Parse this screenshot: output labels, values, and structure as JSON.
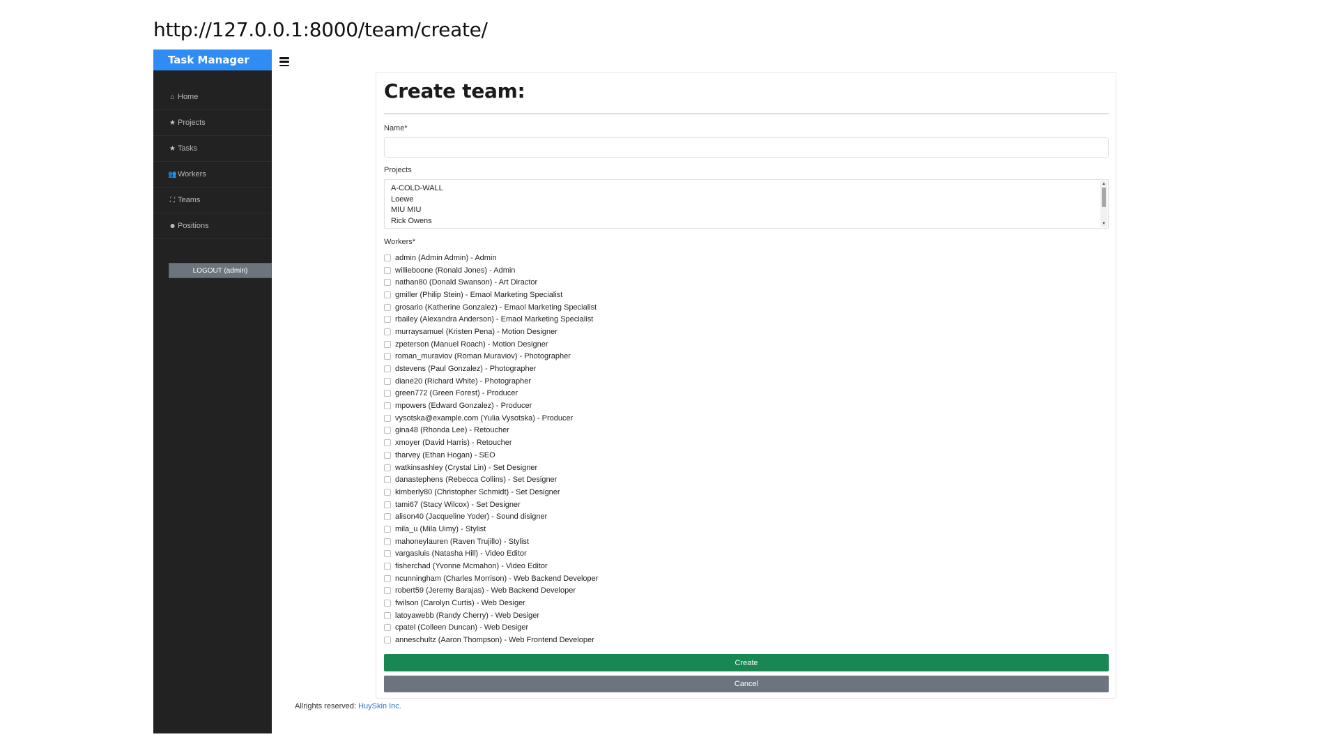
{
  "browser": {
    "url": "http://127.0.0.1:8000/team/create/"
  },
  "sidebar": {
    "brand": "Task Manager",
    "items": [
      {
        "label": "Home",
        "icon": "home-icon",
        "glyph": "⌂"
      },
      {
        "label": "Projects",
        "icon": "star-icon",
        "glyph": "★"
      },
      {
        "label": "Tasks",
        "icon": "star-icon",
        "glyph": "★"
      },
      {
        "label": "Workers",
        "icon": "users-icon",
        "glyph": "👥"
      },
      {
        "label": "Teams",
        "icon": "sitemap-icon",
        "glyph": "⛶"
      },
      {
        "label": "Positions",
        "icon": "face-icon",
        "glyph": "☻"
      }
    ],
    "logout_label": "LOGOUT (admin)"
  },
  "header": {
    "menu_icon": "hamburger-icon"
  },
  "form": {
    "title": "Create team:",
    "name_label": "Name*",
    "name_value": "",
    "projects_label": "Projects",
    "projects": [
      "A-COLD-WALL",
      "Loewe",
      "MIU MIU",
      "Rick Owens"
    ],
    "workers_label": "Workers*",
    "workers": [
      "admin (Admin Admin) - Admin",
      "willieboone (Ronald Jones) - Admin",
      "nathan80 (Donald Swanson) - Art Diractor",
      "gmiller (Philip Stein) - Emaol Marketing Specialist",
      "grosario (Katherine Gonzalez) - Emaol Marketing Specialist",
      "rbailey (Alexandra Anderson) - Emaol Marketing Specialist",
      "murraysamuel (Kristen Pena) - Motion Designer",
      "zpeterson (Manuel Roach) - Motion Designer",
      "roman_muraviov (Roman Muraviov) - Photographer",
      "dstevens (Paul Gonzalez) - Photographer",
      "diane20 (Richard White) - Photographer",
      "green772 (Green Forest) - Producer",
      "mpowers (Edward Gonzalez) - Producer",
      "vysotska@example.com (Yulia Vysotska) - Producer",
      "gina48 (Rhonda Lee) - Retoucher",
      "xmoyer (David Harris) - Retoucher",
      "tharvey (Ethan Hogan) - SEO",
      "watkinsashley (Crystal Lin) - Set Designer",
      "danastephens (Rebecca Collins) - Set Designer",
      "kimberly80 (Christopher Schmidt) - Set Designer",
      "tami67 (Stacy Wilcox) - Set Designer",
      "alison40 (Jacqueline Yoder) - Sound disigner",
      "mila_u (Mila Uimy) - Stylist",
      "mahoneylauren (Raven Trujillo) - Stylist",
      "vargasluis (Natasha Hill) - Video Editor",
      "fisherchad (Yvonne Mcmahon) - Video Editor",
      "ncunningham (Charles Morrison) - Web Backend Developer",
      "robert59 (Jeremy Barajas) - Web Backend Developer",
      "fwilson (Carolyn Curtis) - Web Desiger",
      "latoyawebb (Randy Cherry) - Web Desiger",
      "cpatel (Colleen Duncan) - Web Desiger",
      "anneschultz (Aaron Thompson) - Web Frontend Developer"
    ],
    "create_label": "Create",
    "cancel_label": "Cancel"
  },
  "footer": {
    "text": "Allrights reserved:",
    "link": "HuySkin Inc."
  },
  "colors": {
    "brand": "#2f8cf5",
    "sidebar": "#222222",
    "create": "#198754",
    "cancel": "#6c757d"
  }
}
